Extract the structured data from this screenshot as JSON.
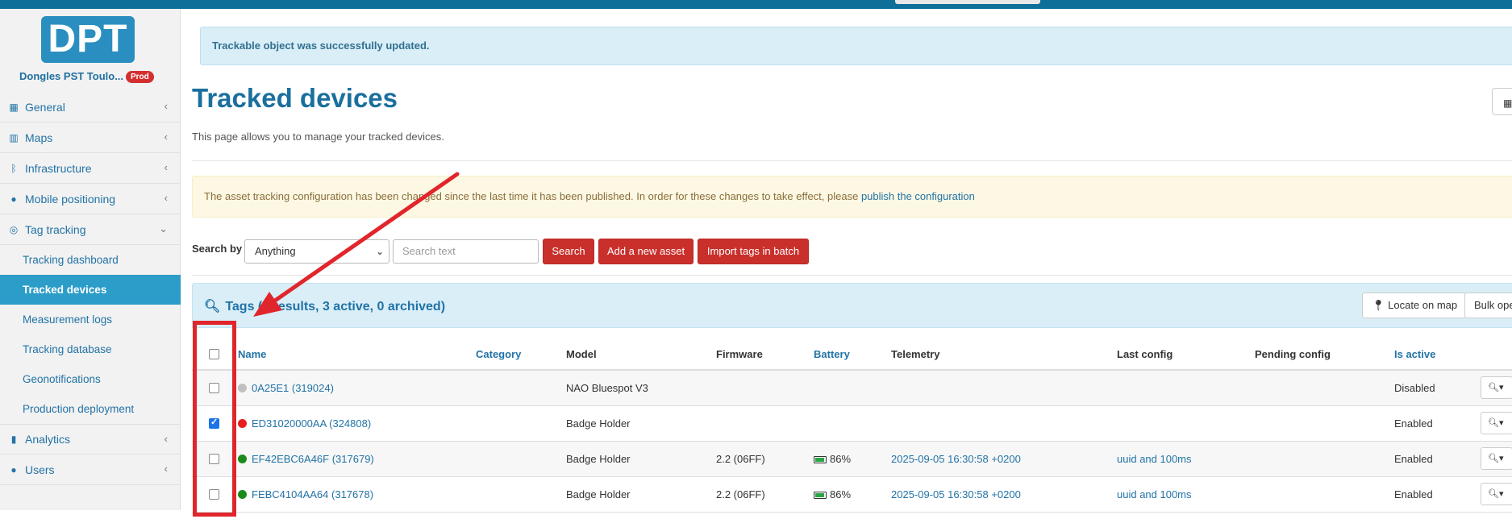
{
  "sidebar": {
    "logo": "DPT",
    "site_name": "Dongles PST Toulo...",
    "env_badge": "Prod",
    "items": [
      {
        "label": "General",
        "icon": "building-icon"
      },
      {
        "label": "Maps",
        "icon": "map-icon"
      },
      {
        "label": "Infrastructure",
        "icon": "bluetooth-icon"
      },
      {
        "label": "Mobile positioning",
        "icon": "map-marker-icon"
      },
      {
        "label": "Tag tracking",
        "icon": "target-icon"
      }
    ],
    "sub_items": [
      {
        "label": "Tracking dashboard"
      },
      {
        "label": "Tracked devices"
      },
      {
        "label": "Measurement logs"
      },
      {
        "label": "Tracking database"
      },
      {
        "label": "Geonotifications"
      },
      {
        "label": "Production deployment"
      }
    ],
    "bottom_items": [
      {
        "label": "Analytics",
        "icon": "bar-chart-icon"
      },
      {
        "label": "Users",
        "icon": "user-icon"
      }
    ]
  },
  "alerts": {
    "success": "Trackable object was successfully updated.",
    "warning_text": "The asset tracking configuration has been changed since the last time it has been published. In order for these changes to take effect, please ",
    "warning_link": "publish the configuration"
  },
  "page": {
    "title": "Tracked devices",
    "description": "This page allows you to manage your tracked devices."
  },
  "search": {
    "label": "Search by",
    "select_value": "Anything",
    "placeholder": "Search text",
    "search_button": "Search",
    "add_button": "Add a new asset",
    "import_button": "Import tags in batch"
  },
  "panel": {
    "title": "Tags (4 results, 3 active, 0 archived)",
    "locate_button": "Locate on map",
    "bulk_button": "Bulk ope"
  },
  "table": {
    "headers": {
      "name": "Name",
      "category": "Category",
      "model": "Model",
      "firmware": "Firmware",
      "battery": "Battery",
      "telemetry": "Telemetry",
      "last_config": "Last config",
      "pending_config": "Pending config",
      "is_active": "Is active"
    },
    "rows": [
      {
        "checked": false,
        "status_color": "#c0c0c0",
        "name": "0A25E1 (319024)",
        "category": "",
        "model": "NAO Bluespot V3",
        "firmware": "",
        "battery": "",
        "telemetry": "",
        "last_config": "",
        "pending_config": "",
        "is_active": "Disabled"
      },
      {
        "checked": true,
        "status_color": "#e81e1e",
        "name": "ED31020000AA (324808)",
        "category": "",
        "model": "Badge Holder",
        "firmware": "",
        "battery": "",
        "telemetry": "",
        "last_config": "",
        "pending_config": "",
        "is_active": "Enabled"
      },
      {
        "checked": false,
        "status_color": "#1b8a1b",
        "name": "EF42EBC6A46F (317679)",
        "category": "",
        "model": "Badge Holder",
        "firmware": "2.2 (06FF)",
        "battery": "86%",
        "telemetry": "2025-09-05 16:30:58 +0200",
        "last_config": "uuid and 100ms",
        "pending_config": "",
        "is_active": "Enabled"
      },
      {
        "checked": false,
        "status_color": "#1b8a1b",
        "name": "FEBC4104AA64 (317678)",
        "category": "",
        "model": "Badge Holder",
        "firmware": "2.2 (06FF)",
        "battery": "86%",
        "telemetry": "2025-09-05 16:30:58 +0200",
        "last_config": "uuid and 100ms",
        "pending_config": "",
        "is_active": "Enabled"
      }
    ]
  },
  "colors": {
    "primary": "#2273a6",
    "danger": "#c9302c",
    "annotation": "#e0262c"
  }
}
